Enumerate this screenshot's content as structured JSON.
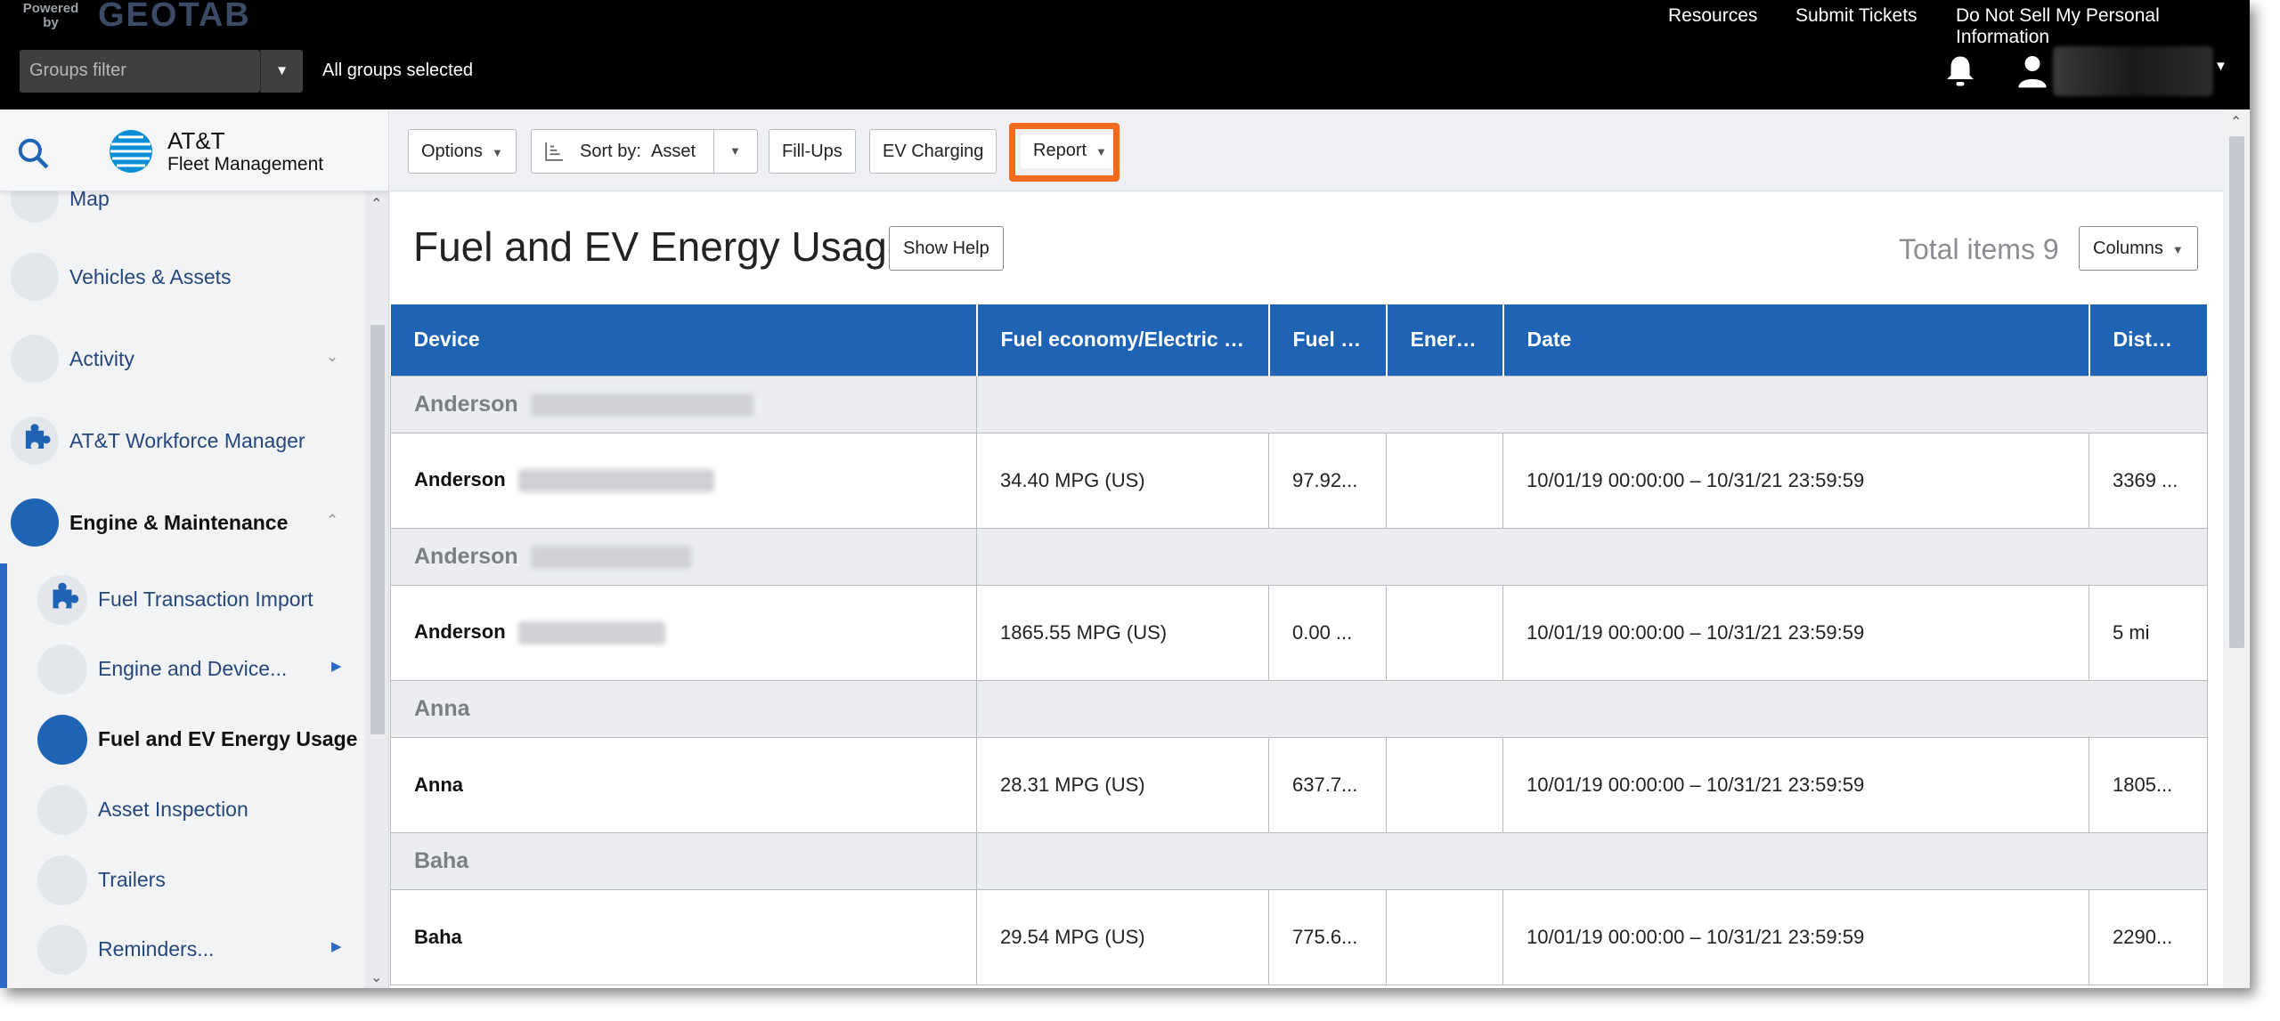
{
  "header": {
    "powered_by": "Powered by",
    "brand": "GEOTAB",
    "links": [
      "Resources",
      "Submit Tickets",
      "Do Not Sell My Personal Information"
    ],
    "groups_filter_placeholder": "Groups filter",
    "groups_status": "All groups selected"
  },
  "sidebar": {
    "brand_name": "AT&T",
    "brand_sub": "Fleet Management",
    "items": [
      {
        "label": "Map"
      },
      {
        "label": "Vehicles & Assets"
      },
      {
        "label": "Activity"
      },
      {
        "label": "AT&T Workforce Manager"
      },
      {
        "label": "Engine & Maintenance"
      }
    ],
    "subitems": [
      {
        "label": "Fuel Transaction Import"
      },
      {
        "label": "Engine and Device..."
      },
      {
        "label": "Fuel and EV Energy Usage"
      },
      {
        "label": "Asset Inspection"
      },
      {
        "label": "Trailers"
      },
      {
        "label": "Reminders..."
      }
    ]
  },
  "toolbar": {
    "options": "Options",
    "sort_prefix": "Sort by:",
    "sort_value": "Asset",
    "fillups": "Fill-Ups",
    "ev_charging": "EV Charging",
    "report": "Report"
  },
  "page": {
    "title": "Fuel and EV Energy Usage",
    "show_help": "Show Help",
    "total_items": "Total items 9",
    "columns": "Columns"
  },
  "table": {
    "headers": [
      "Device",
      "Fuel economy/Electric e...",
      "Fuel us...",
      "Energy...",
      "Date",
      "Distance"
    ],
    "rows": [
      {
        "group": "Anderson",
        "device": "Anderson",
        "economy": "34.40 MPG (US)",
        "fuel": "97.92...",
        "energy": "",
        "date": "10/01/19 00:00:00 – 10/31/21 23:59:59",
        "distance": "3369 ..."
      },
      {
        "group": "Anderson",
        "device": "Anderson",
        "economy": "1865.55 MPG (US)",
        "fuel": "0.00 ...",
        "energy": "",
        "date": "10/01/19 00:00:00 – 10/31/21 23:59:59",
        "distance": "5 mi"
      },
      {
        "group": "Anna",
        "device": "Anna",
        "economy": "28.31 MPG (US)",
        "fuel": "637.7...",
        "energy": "",
        "date": "10/01/19 00:00:00 – 10/31/21 23:59:59",
        "distance": "1805..."
      },
      {
        "group": "Baha",
        "device": "Baha",
        "economy": "29.54 MPG (US)",
        "fuel": "775.6...",
        "energy": "",
        "date": "10/01/19 00:00:00 – 10/31/21 23:59:59",
        "distance": "2290..."
      }
    ]
  },
  "colors": {
    "accent": "#1f63b5",
    "highlight": "#f26b1d",
    "nav_text": "#25477b"
  }
}
